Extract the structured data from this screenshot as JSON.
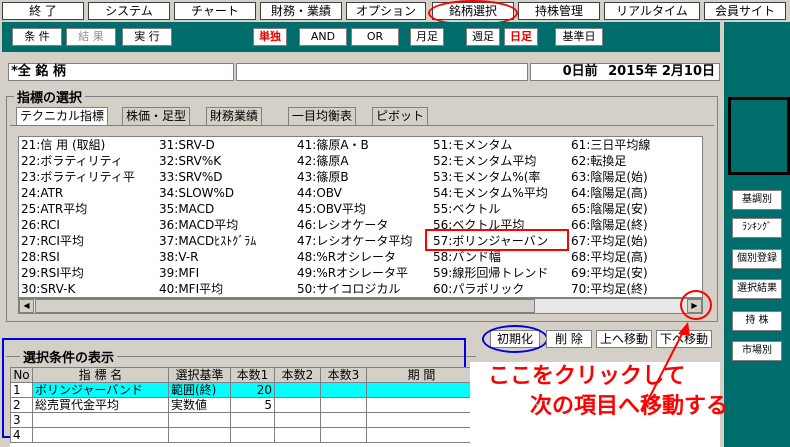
{
  "menu": {
    "items": [
      "終 了",
      "システム",
      "チャート",
      "財務・業績",
      "オプション",
      "銘柄選択",
      "持株管理",
      "リアルタイム",
      "会員サイト"
    ]
  },
  "toolbar": {
    "jouken": "条 件",
    "kekka": "結 果",
    "jikkou": "実 行",
    "tandoku": "単独",
    "and": "AND",
    "or": "OR",
    "getsuashi": "月足",
    "shuashi": "週足",
    "hiashi": "日足",
    "kijunbi": "基準日"
  },
  "status": {
    "name": "*全 銘 柄",
    "blank": "",
    "days_before": "0日前",
    "date": "2015年 2月10日"
  },
  "indicator_section": {
    "title": "指標の選択",
    "tabs": [
      "テクニカル指標",
      "株価・足型",
      "財務業績",
      "一目均衡表",
      "ピボット"
    ]
  },
  "indicators": {
    "col1": [
      "21:信 用 (取組)",
      "22:ボラティリティ",
      "23:ボラティリティ平",
      "24:ATR",
      "25:ATR平均",
      "26:RCI",
      "27:RCI平均",
      "28:RSI",
      "29:RSI平均",
      "30:SRV-K"
    ],
    "col2": [
      "31:SRV-D",
      "32:SRV%K",
      "33:SRV%D",
      "34:SLOW%D",
      "35:MACD",
      "36:MACD平均",
      "37:MACDﾋｽﾄｸﾞﾗﾑ",
      "38:V-R",
      "39:MFI",
      "40:MFI平均"
    ],
    "col3": [
      "41:篠原A・B",
      "42:篠原A",
      "43:篠原B",
      "44:OBV",
      "45:OBV平均",
      "46:レシオケータ",
      "47:レシオケータ平均",
      "48:%Rオシレータ",
      "49:%Rオシレータ平",
      "50:サイコロジカル"
    ],
    "col4": [
      "51:モメンタム",
      "52:モメンタム平均",
      "53:モメンタム%(率",
      "54:モメンタム%平均",
      "55:ベクトル",
      "56:ベクトル平均",
      "57:ボリンジャーバン",
      "58:バンド幅",
      "59:線形回帰トレンド",
      "60:パラボリック"
    ],
    "col5": [
      "61:三日平均線",
      "62:転換足",
      "63:陰陽足(始)",
      "64:陰陽足(高)",
      "65:陰陽足(安)",
      "66:陰陽足(終)",
      "67:平均足(始)",
      "68:平均足(高)",
      "69:平均足(安)",
      "70:平均足(終)"
    ]
  },
  "actions": {
    "init": "初期化",
    "delete": "削 除",
    "move_up": "上へ移動",
    "move_down": "下へ移動"
  },
  "right_panel": [
    "基調別",
    "ﾗﾝｷﾝｸﾞ",
    "個別登録",
    "選択結果",
    "持 株",
    "市場別"
  ],
  "conditions": {
    "title": "選択条件の表示",
    "headers": [
      "No",
      "指 標 名",
      "選択基準",
      "本数1",
      "本数2",
      "本数3",
      "期 間"
    ],
    "rows": [
      {
        "no": "1",
        "name": "ボリンジャーバンド",
        "criterion": "範囲(終)",
        "n1": "20",
        "n2": "",
        "n3": "",
        "period": ""
      },
      {
        "no": "2",
        "name": "総売買代金平均",
        "criterion": "実数値",
        "n1": "5",
        "n2": "",
        "n3": "",
        "period": ""
      },
      {
        "no": "3",
        "name": "",
        "criterion": "",
        "n1": "",
        "n2": "",
        "n3": "",
        "period": ""
      },
      {
        "no": "4",
        "name": "",
        "criterion": "",
        "n1": "",
        "n2": "",
        "n3": "",
        "period": ""
      }
    ]
  },
  "annotation": {
    "line1": "ここをクリックして",
    "line2": "次の項目へ移動する"
  },
  "colors": {
    "teal": "#006d6d",
    "highlight_row": "#00ffff",
    "annotation_red": "#ff0000",
    "annotation_blue": "#0000e0"
  }
}
